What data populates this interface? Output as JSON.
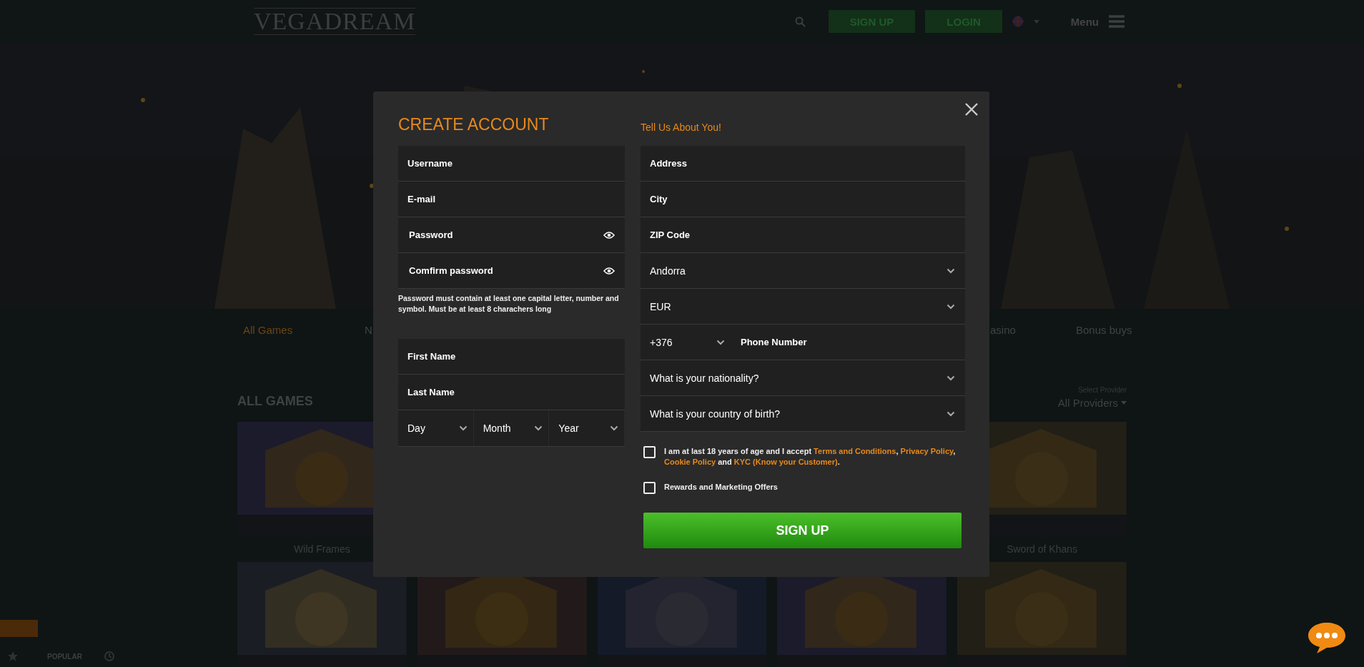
{
  "header": {
    "logo": "VEGADREAM",
    "signup": "SIGN UP",
    "login": "LOGIN",
    "menu": "Menu"
  },
  "categories": [
    {
      "label": "All Games",
      "selected": true
    },
    {
      "label": "N",
      "selected": false
    },
    {
      "label": "asino",
      "selected": false
    },
    {
      "label": "Bonus buys",
      "selected": false
    }
  ],
  "section": {
    "title": "ALL GAMES",
    "provider_label": "Select Provider",
    "provider_value": "All Providers"
  },
  "games_row_1": [
    {
      "title": "Wild Frames"
    },
    {
      "title": "Sword of Khans"
    }
  ],
  "bottom_bar": {
    "tab": "POPULAR"
  },
  "modal": {
    "title": "CREATE ACCOUNT",
    "subtitle": "Tell Us About You!",
    "account_fields": [
      {
        "kind": "text",
        "placeholder": "Username"
      },
      {
        "kind": "text",
        "placeholder": "E-mail"
      },
      {
        "kind": "password",
        "placeholder": "Password"
      },
      {
        "kind": "password",
        "placeholder": "Comfirm password"
      }
    ],
    "password_hint": "Password must contain at least one capital letter, number and symbol. Must be at least 8 charachers long",
    "name_fields": [
      {
        "kind": "text",
        "placeholder": "First Name"
      },
      {
        "kind": "text",
        "placeholder": "Last Name"
      }
    ],
    "date_selects": [
      {
        "value": "Day"
      },
      {
        "value": "Month"
      },
      {
        "value": "Year"
      }
    ],
    "about_fields": [
      {
        "kind": "text",
        "placeholder": "Address"
      },
      {
        "kind": "text",
        "placeholder": "City"
      },
      {
        "kind": "text",
        "placeholder": "ZIP Code"
      },
      {
        "kind": "select",
        "value": "Andorra"
      },
      {
        "kind": "select",
        "value": "EUR"
      },
      {
        "kind": "phone",
        "code": "+376",
        "placeholder": "Phone Number"
      },
      {
        "kind": "select",
        "value": "What is your nationality?"
      },
      {
        "kind": "select",
        "value": "What is your country of birth?"
      }
    ],
    "consents": [
      {
        "checked": false,
        "parts": [
          {
            "kind": "text",
            "text": "I am at last 18 years of age and I accept "
          },
          {
            "kind": "link",
            "text": "Terms and Conditions"
          },
          {
            "kind": "text",
            "text": ", "
          },
          {
            "kind": "link",
            "text": "Privacy Policy"
          },
          {
            "kind": "text",
            "text": ", "
          },
          {
            "kind": "link",
            "text": "Cookie Policy"
          },
          {
            "kind": "text",
            "text": " and "
          },
          {
            "kind": "link",
            "text": "KYC (Know your Customer)"
          },
          {
            "kind": "text",
            "text": "."
          }
        ]
      },
      {
        "checked": false,
        "parts": [
          {
            "kind": "text",
            "text": "Rewards and Marketing Offers"
          }
        ]
      }
    ],
    "submit": "SIGN UP"
  }
}
